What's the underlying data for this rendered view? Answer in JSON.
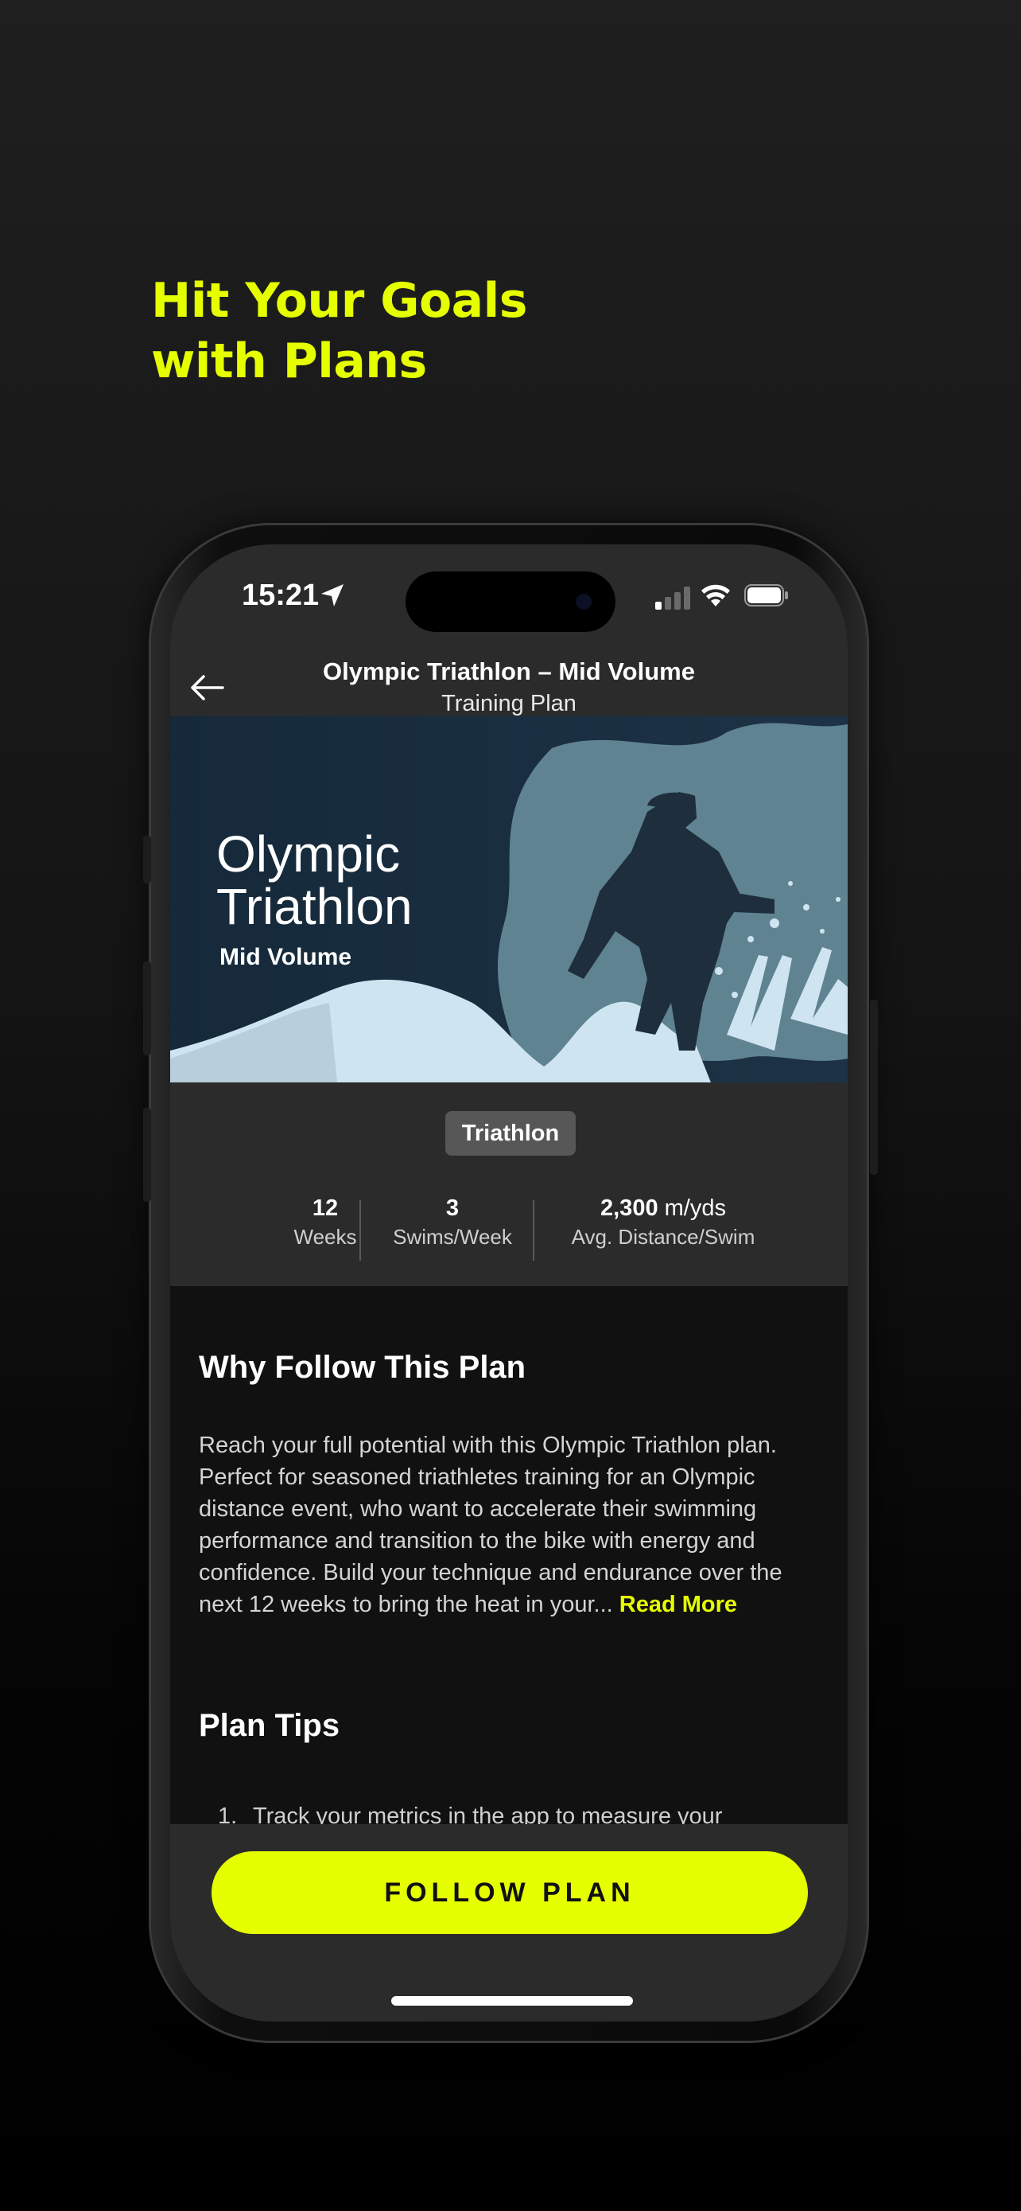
{
  "promo": {
    "headline_line1": "Hit Your Goals",
    "headline_line2": "with Plans"
  },
  "status_bar": {
    "time": "15:21"
  },
  "nav": {
    "title": "Olympic Triathlon – Mid Volume",
    "subtitle": "Training Plan"
  },
  "hero": {
    "title_line1": "Olympic",
    "title_line2": "Triathlon",
    "subtitle": "Mid Volume"
  },
  "plan": {
    "tag": "Triathlon",
    "stats": [
      {
        "value": "12",
        "unit": "",
        "label": "Weeks"
      },
      {
        "value": "3",
        "unit": "",
        "label": "Swims/Week"
      },
      {
        "value": "2,300",
        "unit": " m/yds",
        "label": "Avg. Distance/Swim"
      }
    ]
  },
  "why": {
    "title": "Why Follow This Plan",
    "description": "Reach your full potential with this Olympic Triathlon plan. Perfect for seasoned triathletes training for an Olympic distance event, who want to accelerate their swimming performance and transition to the bike with energy and confidence. Build your technique and endurance over the next 12 weeks to bring the heat in your...",
    "read_more": "Read More"
  },
  "tips": {
    "title": "Plan Tips",
    "items": [
      {
        "number": "1.",
        "text": "Track your metrics in the app to measure your"
      }
    ]
  },
  "cta": {
    "follow_label": "FOLLOW PLAN"
  },
  "colors": {
    "accent": "#e6ff00",
    "panel": "#2b2b2b",
    "background": "#111111"
  },
  "icons": [
    "back-arrow-icon",
    "location-arrow-icon",
    "signal-icon",
    "wifi-icon",
    "battery-icon"
  ]
}
